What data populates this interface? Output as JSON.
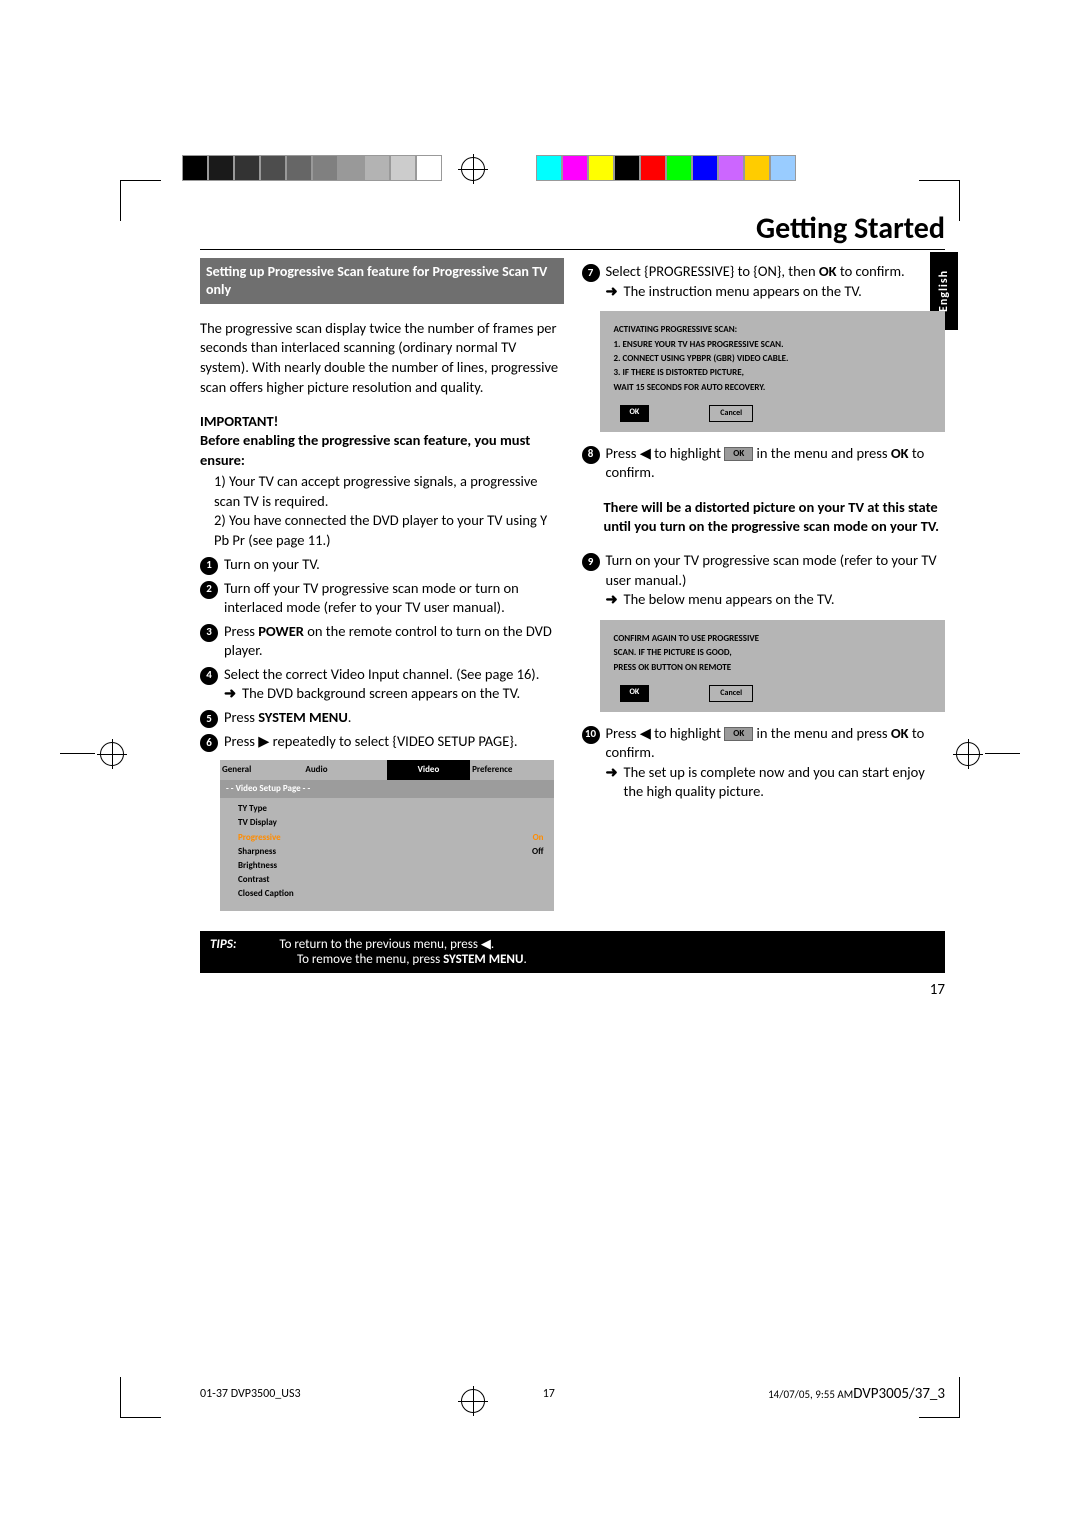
{
  "title": "Getting Started",
  "language_tab": "English",
  "section_heading": "Setting up Progressive Scan feature for Progressive Scan TV only",
  "intro": "The progressive scan display twice the number of frames per seconds than interlaced scanning (ordinary normal TV system). With nearly double the number of lines, progressive scan offers higher picture resolution and quality.",
  "important_label": "IMPORTANT!",
  "important_sub": "Before enabling the progressive scan feature, you must ensure:",
  "ensure_1": "1) Your TV can accept progressive signals, a progressive scan TV is required.",
  "ensure_2": "2) You have connected the DVD player to your TV using Y Pb Pr (see page 11.)",
  "steps_left": {
    "1": "Turn on your TV.",
    "2": "Turn off your TV progressive scan mode or turn on interlaced mode (refer to your TV user manual).",
    "3_a": "Press ",
    "3_b": "POWER",
    "3_c": " on the remote control to turn on the DVD player.",
    "4_a": "Select the correct Video Input channel. (See page 16).",
    "4_arrow": "The DVD background screen appears on the TV.",
    "5_a": "Press ",
    "5_b": "SYSTEM MENU",
    "5_c": ".",
    "6_a": "Press ▶ repeatedly to select {VIDEO SETUP PAGE}."
  },
  "menu": {
    "tabs": [
      "General",
      "Audio",
      "Video",
      "Preference"
    ],
    "subtitle": "- -   Video Setup Page   - -",
    "rows": [
      {
        "label": "TY Type",
        "value": ""
      },
      {
        "label": "TV Display",
        "value": ""
      },
      {
        "label": "Progressive",
        "value": "On",
        "hl": true
      },
      {
        "label": "Sharpness",
        "value": "Off"
      },
      {
        "label": "Brightness",
        "value": ""
      },
      {
        "label": "Contrast",
        "value": ""
      },
      {
        "label": "Closed Caption",
        "value": ""
      }
    ]
  },
  "steps_right": {
    "7_a": "Select {PROGRESSIVE} to {ON}, then ",
    "7_b": "OK",
    "7_c": " to confirm.",
    "7_arrow": "The instruction menu appears on the TV.",
    "8_a": "Press ◀ to highlight ",
    "8_ok": "OK",
    "8_b": " in the menu and press ",
    "8_c": "OK",
    "8_d": " to confirm.",
    "warn": "There will be a distorted picture on your TV at this state until you turn on the progressive scan mode on your TV.",
    "9_a": "Turn on your TV progressive scan mode (refer to your TV user manual.)",
    "9_arrow": "The below menu appears on the TV.",
    "10_a": "Press ◀ to highlight ",
    "10_ok": "OK",
    "10_b": " in the menu and press ",
    "10_c": "OK",
    "10_d": " to confirm.",
    "10_arrow": "The set up is complete now and you can start enjoy the high quality picture."
  },
  "dialog1": {
    "title": "ACTIVATING PROGRESSIVE SCAN:",
    "l1": "1. ENSURE YOUR TV HAS PROGRESSIVE SCAN.",
    "l2": "2. CONNECT USING YPBPR (GBR) VIDEO CABLE.",
    "l3": "3. IF THERE IS DISTORTED PICTURE,",
    "l4": "    WAIT 15 SECONDS FOR AUTO RECOVERY.",
    "ok": "OK",
    "cancel": "Cancel"
  },
  "dialog2": {
    "l1": "CONFIRM AGAIN TO USE PROGRESSIVE",
    "l2": "SCAN.   IF THE PICTURE IS GOOD,",
    "l3": "PRESS OK BUTTON ON REMOTE",
    "ok": "OK",
    "cancel": "Cancel"
  },
  "tips": {
    "label": "TIPS:",
    "line1": "To return to the previous menu, press ◀.",
    "line2a": "To remove the menu, press ",
    "line2b": "SYSTEM MENU",
    "line2c": "."
  },
  "page_number": "17",
  "footer": {
    "left": "01-37 DVP3500_US3",
    "mid": "17",
    "right_time": "14/07/05, 9:55 AM",
    "right_model": "DVP3005/37_3"
  }
}
